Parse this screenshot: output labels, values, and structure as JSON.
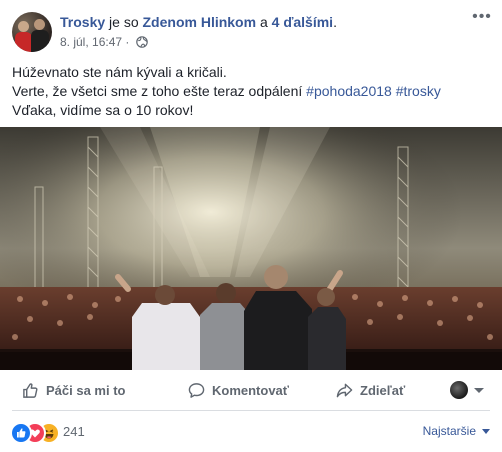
{
  "header": {
    "page_name": "Trosky",
    "with_text": "je so",
    "tagged_person": "Zdenom Hlinkom",
    "and_text": "a",
    "others_text": "4 ďalšími",
    "period": ".",
    "timestamp": "8. júl, 16:47 ·",
    "audience_icon": "globe-icon",
    "more_icon": "more-options-icon"
  },
  "post_text": {
    "line1": "Húževnato ste nám kývali a kričali.",
    "line2_prefix": "Verte, že všetci sme z toho ešte teraz odpálení",
    "hashtag1": "#pohoda2018",
    "hashtag2": "#trosky",
    "line3": "Vďaka, vidíme sa o 10 rokov!"
  },
  "photo": {
    "subject": "band on stage facing crowd"
  },
  "actions": {
    "like_label": "Páči sa mi to",
    "comment_label": "Komentovať",
    "share_label": "Zdieľať"
  },
  "reactions": {
    "icons": [
      "like-reaction-icon",
      "love-reaction-icon",
      "haha-reaction-icon"
    ],
    "count": "241",
    "sort_label": "Najstaršie"
  },
  "colors": {
    "link": "#385898",
    "text": "#1d2129",
    "muted": "#616770",
    "like_blue": "#1877f2",
    "love_red": "#f33e58",
    "haha_yellow": "#f7b125"
  }
}
